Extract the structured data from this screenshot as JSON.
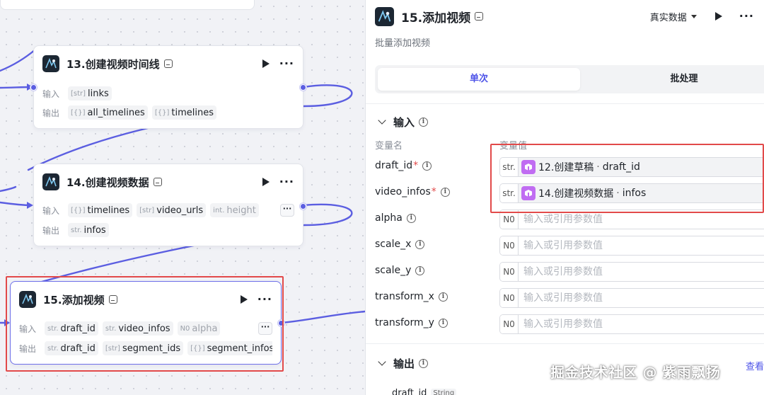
{
  "canvas": {
    "nodes": [
      {
        "title": "13.创建视频时间线",
        "input_label": "输入",
        "output_label": "输出",
        "inputs": [
          {
            "type": "[str]",
            "name": "links"
          }
        ],
        "outputs": [
          {
            "type": "[{}]",
            "name": "all_timelines"
          },
          {
            "type": "[{}]",
            "name": "timelines"
          }
        ]
      },
      {
        "title": "14.创建视频数据",
        "input_label": "输入",
        "output_label": "输出",
        "inputs": [
          {
            "type": "[{}]",
            "name": "timelines"
          },
          {
            "type": "[str]",
            "name": "video_urls"
          },
          {
            "type": "int.",
            "name": "height"
          }
        ],
        "outputs": [
          {
            "type": "str.",
            "name": "infos"
          }
        ],
        "more": "···"
      },
      {
        "title": "15.添加视频",
        "input_label": "输入",
        "output_label": "输出",
        "inputs": [
          {
            "type": "str.",
            "name": "draft_id"
          },
          {
            "type": "str.",
            "name": "video_infos"
          },
          {
            "type": "N0",
            "name": "alpha"
          }
        ],
        "outputs": [
          {
            "type": "str.",
            "name": "draft_id"
          },
          {
            "type": "[str]",
            "name": "segment_ids"
          },
          {
            "type": "[{}]",
            "name": "segment_infos"
          }
        ],
        "more": "···"
      }
    ]
  },
  "panel": {
    "title": "15.添加视频",
    "data_mode": "真实数据",
    "description": "批量添加视频",
    "tabs": [
      "单次",
      "批处理"
    ],
    "input_section": "输入",
    "col_name": "变量名",
    "col_value": "变量值",
    "params": [
      {
        "name": "draft_id",
        "required": "*",
        "type": "str.",
        "ref_node": "12.创建草稿",
        "ref_field": "draft_id"
      },
      {
        "name": "video_infos",
        "required": "*",
        "type": "str.",
        "ref_node": "14.创建视频数据",
        "ref_field": "infos"
      },
      {
        "name": "alpha",
        "type": "N0",
        "placeholder": "输入或引用参数值"
      },
      {
        "name": "scale_x",
        "type": "N0",
        "placeholder": "输入或引用参数值"
      },
      {
        "name": "scale_y",
        "type": "N0",
        "placeholder": "输入或引用参数值"
      },
      {
        "name": "transform_x",
        "type": "N0",
        "placeholder": "输入或引用参数值"
      },
      {
        "name": "transform_y",
        "type": "N0",
        "placeholder": "输入或引用参数值"
      }
    ],
    "output_section": "输出",
    "output_peek": {
      "name": "draft_id",
      "type": "String"
    },
    "peek_link": "查看"
  },
  "watermark": "掘金技术社区 @ 紫雨飘扬",
  "colors": {
    "accent": "#4d53e8",
    "edge": "#5b5ee1",
    "highlight": "#e24a4a",
    "ref_icon": "#c06cf2"
  }
}
